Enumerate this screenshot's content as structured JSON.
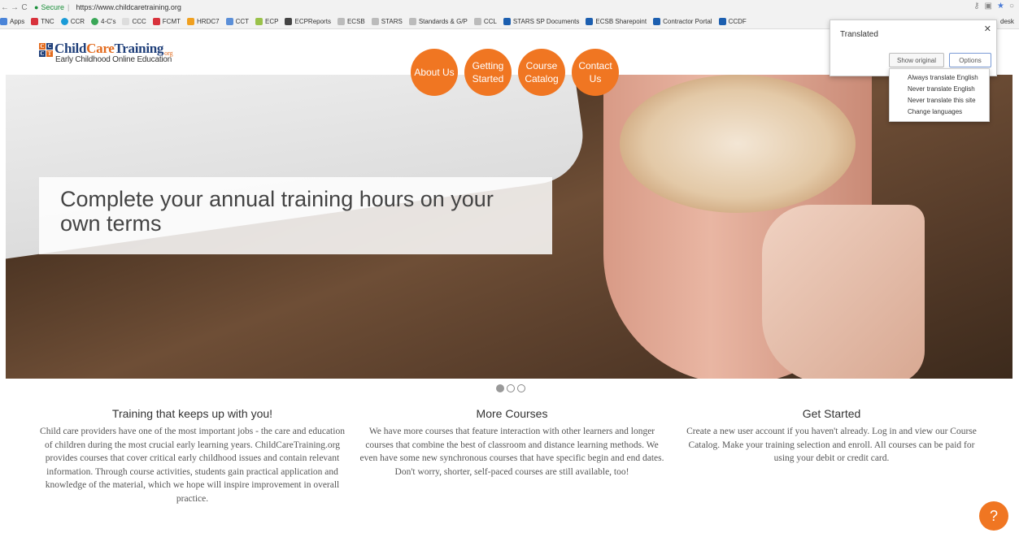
{
  "browser": {
    "secure_label": "Secure",
    "url": "https://www.childcaretraining.org",
    "bookmarks": [
      "Apps",
      "TNC",
      "CCR",
      "4-C's",
      "CCC",
      "FCMT",
      "HRDC7",
      "CCT",
      "ECP",
      "ECPReports",
      "ECSB",
      "STARS",
      "Standards & G/P",
      "CCL",
      "STARS SP Documents",
      "ECSB Sharepoint",
      "Contractor Portal",
      "CCDF"
    ],
    "bookmark_trailing": "desk"
  },
  "translate_popup": {
    "title": "Translated",
    "show_original": "Show original",
    "options": "Options",
    "menu": [
      "Always translate English",
      "Never translate English",
      "Never translate this site",
      "Change languages"
    ]
  },
  "logo": {
    "cc_letters": [
      "C",
      "C",
      "C",
      "T"
    ],
    "name_part1": "Child",
    "name_part2": "Care",
    "name_part3": "Training",
    "org": "org",
    "subtitle": "Early Childhood Online Education"
  },
  "nav": {
    "about": "About Us",
    "getting_started": "Getting Started",
    "course_catalog": "Course Catalog",
    "contact": "Contact Us"
  },
  "hero": {
    "caption": "Complete your annual training hours on your own terms"
  },
  "carousel": {
    "count": 3,
    "active": 1
  },
  "columns": [
    {
      "heading": "Training that keeps up with you!",
      "text": "Child care providers have one of the most important jobs - the care and education of children during the most crucial early learning years. ChildCareTraining.org provides courses that cover critical early childhood issues and contain relevant information. Through course activities, students gain practical application and knowledge of the material, which we hope will inspire improvement in overall practice."
    },
    {
      "heading": "More Courses",
      "text": "We have more courses that feature interaction with other learners and longer courses that combine the best of classroom and distance learning methods. We even have some new synchronous courses that have specific begin and end dates. Don't worry, shorter, self-paced courses are still available, too!"
    },
    {
      "heading": "Get Started",
      "text": "Create a new user account if you haven't already. Log in and view our Course Catalog. Make your training selection and enroll. All courses can be paid for using your debit or credit card."
    }
  ],
  "help_button": "?",
  "colors": {
    "accent": "#f07622",
    "logo_blue": "#1f3f7a"
  }
}
